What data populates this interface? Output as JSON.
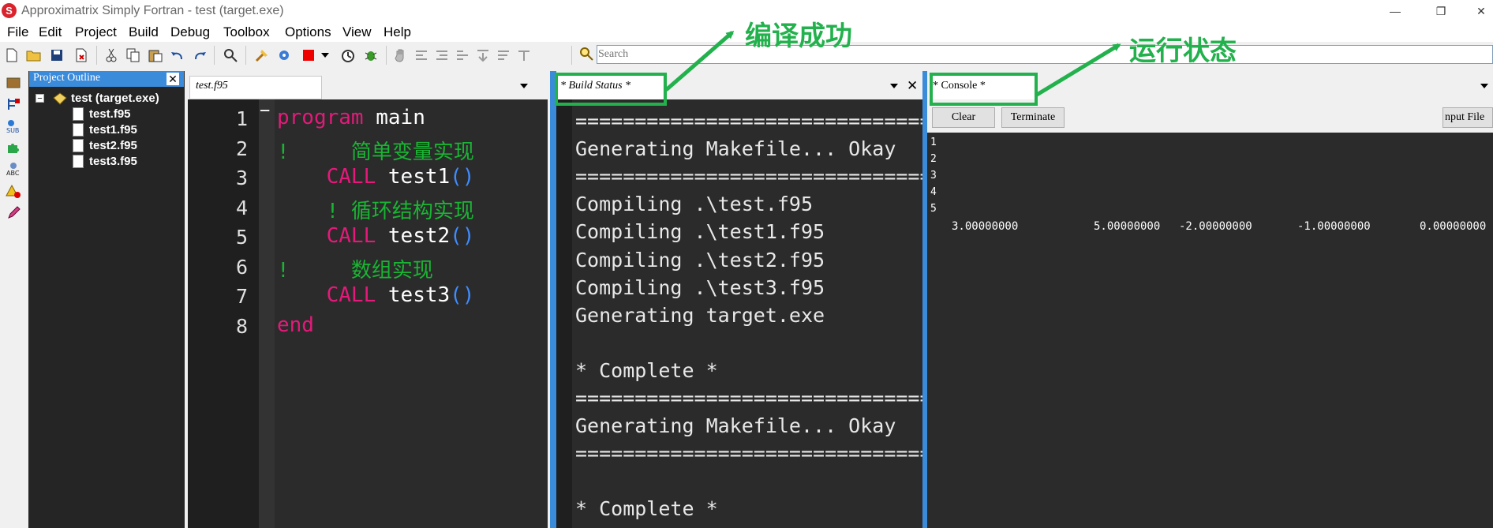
{
  "window": {
    "title": "Approximatrix Simply Fortran - test (target.exe)",
    "app_icon_glyph": "S",
    "minimize_glyph": "—",
    "restore_glyph": "❐",
    "close_glyph": "✕"
  },
  "menu": [
    "File",
    "Edit",
    "Project",
    "Build",
    "Debug",
    "Toolbox",
    "Options",
    "View",
    "Help"
  ],
  "search": {
    "placeholder": "Search"
  },
  "project_outline": {
    "title": "Project Outline",
    "close_glyph": "✕",
    "expander_glyph": "−",
    "root": "test (target.exe)",
    "files": [
      "test.f95",
      "test1.f95",
      "test2.f95",
      "test3.f95"
    ]
  },
  "editor": {
    "tab_label": "test.f95",
    "fold_marker": "−",
    "line_numbers": [
      "1",
      "2",
      "3",
      "4",
      "5",
      "6",
      "7",
      "8"
    ],
    "lines": [
      [
        {
          "t": "program",
          "c": "kw"
        },
        {
          "t": " main",
          "c": "id"
        }
      ],
      [
        {
          "t": "!     简单变量实现",
          "c": "cm"
        }
      ],
      [
        {
          "t": "    CALL",
          "c": "kw"
        },
        {
          "t": " test1",
          "c": "id"
        },
        {
          "t": "()",
          "c": "pn"
        }
      ],
      [
        {
          "t": "    ! 循环结构实现",
          "c": "cm"
        }
      ],
      [
        {
          "t": "    CALL",
          "c": "kw"
        },
        {
          "t": " test2",
          "c": "id"
        },
        {
          "t": "()",
          "c": "pn"
        }
      ],
      [
        {
          "t": "!     数组实现",
          "c": "cm"
        }
      ],
      [
        {
          "t": "    CALL",
          "c": "kw"
        },
        {
          "t": " test3",
          "c": "id"
        },
        {
          "t": "()",
          "c": "pn"
        }
      ],
      [
        {
          "t": "end",
          "c": "kw"
        }
      ]
    ]
  },
  "build_status": {
    "tab_label": "* Build Status *",
    "close_glyph": "✕",
    "lines": [
      "==============================",
      "Generating Makefile... Okay",
      "==============================",
      "Compiling .\\test.f95",
      "Compiling .\\test1.f95",
      "Compiling .\\test2.f95",
      "Compiling .\\test3.f95",
      "Generating target.exe",
      "",
      "* Complete *",
      "==============================",
      "Generating Makefile... Okay",
      "==============================",
      "",
      "* Complete *"
    ]
  },
  "console": {
    "tab_label": "* Console *",
    "clear_label": "Clear",
    "terminate_label": "Terminate",
    "input_file_label": "nput File",
    "line_numbers": [
      "1",
      "2",
      "3",
      "4",
      "5"
    ],
    "values": [
      "3.00000000",
      "5.00000000",
      "-2.00000000",
      "-1.00000000",
      "0.00000000"
    ]
  },
  "annotations": {
    "build_success": "编译成功",
    "run_status": "运行状态",
    "color": "#22b14c"
  },
  "colors": {
    "keyword": "#e5197a",
    "comment": "#19b533",
    "identifier": "#ffffff",
    "paren": "#3f8cff",
    "panel_border": "#3b8bdb"
  }
}
